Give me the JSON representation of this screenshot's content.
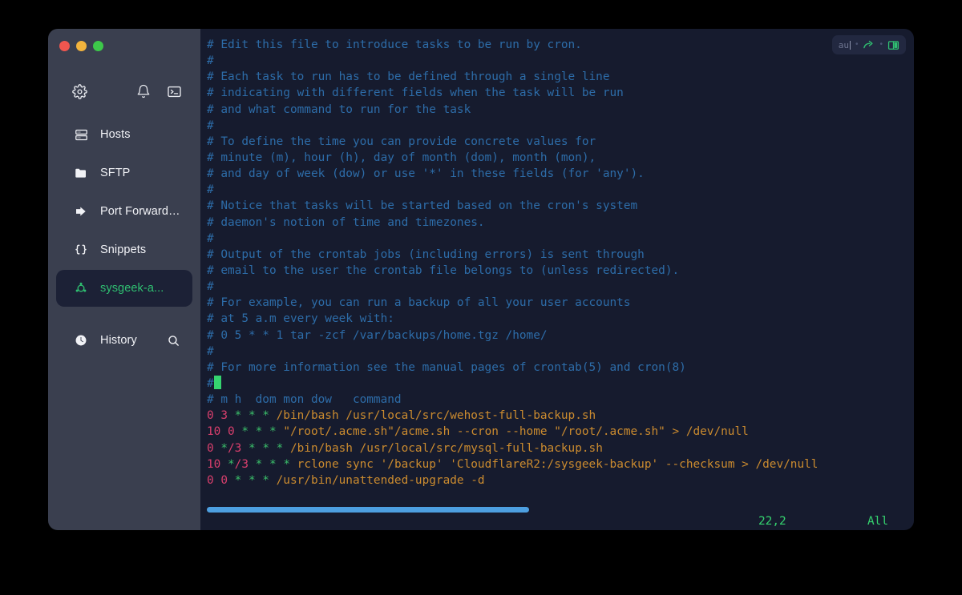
{
  "window": {
    "traffic_lights": [
      {
        "name": "close",
        "color": "#f0564f"
      },
      {
        "name": "minimize",
        "color": "#f2b33d"
      },
      {
        "name": "zoom",
        "color": "#3dc84a"
      }
    ]
  },
  "sidebar": {
    "top_icons": [
      {
        "name": "gear-icon",
        "label": "Settings"
      },
      {
        "name": "bell-icon",
        "label": "Notifications"
      },
      {
        "name": "terminal-icon",
        "label": "Terminal"
      }
    ],
    "items": [
      {
        "label": "Hosts",
        "icon": "server-icon",
        "active": false
      },
      {
        "label": "SFTP",
        "icon": "folder-icon",
        "active": false
      },
      {
        "label": "Port Forwarding",
        "icon": "forward-arrow-icon",
        "active": false
      },
      {
        "label": "Snippets",
        "icon": "braces-icon",
        "active": false
      },
      {
        "label": "sysgeek-a...",
        "icon": "ubuntu-icon",
        "active": true
      }
    ],
    "history": {
      "label": "History",
      "icon": "clock-icon",
      "trailing_icon": "search-icon"
    },
    "accent_color": "#2fbf71",
    "background_color": "#3a3f4f",
    "active_background_color": "#1c2136"
  },
  "terminal": {
    "background_color": "#161b2e",
    "toolbar": {
      "text": "au",
      "send_icon": "share-arrow-icon",
      "split_icon": "split-pane-icon",
      "accent_color": "#2fbf71"
    },
    "colors": {
      "comment": "#2d6ca8",
      "number": "#d93f6d",
      "asterisk": "#3bbf6a",
      "path": "#cb8b2f",
      "cursor": "#35d46f",
      "scrollbar": "#4d9fe0",
      "status": "#35d46f"
    },
    "lines": [
      [
        {
          "t": "# Edit this file to introduce tasks to be run by cron.",
          "c": "comment"
        }
      ],
      [
        {
          "t": "#",
          "c": "comment"
        }
      ],
      [
        {
          "t": "# Each task to run has to be defined through a single line",
          "c": "comment"
        }
      ],
      [
        {
          "t": "# indicating with different fields when the task will be run",
          "c": "comment"
        }
      ],
      [
        {
          "t": "# and what command to run for the task",
          "c": "comment"
        }
      ],
      [
        {
          "t": "#",
          "c": "comment"
        }
      ],
      [
        {
          "t": "# To define the time you can provide concrete values for",
          "c": "comment"
        }
      ],
      [
        {
          "t": "# minute (m), hour (h), day of month (dom), month (mon),",
          "c": "comment"
        }
      ],
      [
        {
          "t": "# and day of week (dow) or use '*' in these fields (for 'any').",
          "c": "comment"
        }
      ],
      [
        {
          "t": "#",
          "c": "comment"
        }
      ],
      [
        {
          "t": "# Notice that tasks will be started based on the cron's system",
          "c": "comment"
        }
      ],
      [
        {
          "t": "# daemon's notion of time and timezones.",
          "c": "comment"
        }
      ],
      [
        {
          "t": "#",
          "c": "comment"
        }
      ],
      [
        {
          "t": "# Output of the crontab jobs (including errors) is sent through",
          "c": "comment"
        }
      ],
      [
        {
          "t": "# email to the user the crontab file belongs to (unless redirected).",
          "c": "comment"
        }
      ],
      [
        {
          "t": "#",
          "c": "comment"
        }
      ],
      [
        {
          "t": "# For example, you can run a backup of all your user accounts",
          "c": "comment"
        }
      ],
      [
        {
          "t": "# at 5 a.m every week with:",
          "c": "comment"
        }
      ],
      [
        {
          "t": "# 0 5 * * 1 tar -zcf /var/backups/home.tgz /home/",
          "c": "comment"
        }
      ],
      [
        {
          "t": "#",
          "c": "comment"
        }
      ],
      [
        {
          "t": "# For more information see the manual pages of crontab(5) and cron(8)",
          "c": "comment"
        }
      ],
      [
        {
          "t": "#",
          "c": "comment"
        },
        {
          "t": "",
          "c": "cursor"
        }
      ],
      [
        {
          "t": "# m h  dom mon dow   command",
          "c": "comment"
        }
      ],
      [
        {
          "t": "0 3 ",
          "c": "num"
        },
        {
          "t": "* * * ",
          "c": "star"
        },
        {
          "t": "/bin/bash /usr/local/src/wehost-full-backup.sh",
          "c": "path"
        }
      ],
      [
        {
          "t": "10 0 ",
          "c": "num"
        },
        {
          "t": "* * * ",
          "c": "star"
        },
        {
          "t": "\"/root/.acme.sh\"/acme.sh --cron --home \"/root/.acme.sh\" > /dev/null",
          "c": "path"
        }
      ],
      [
        {
          "t": "0 ",
          "c": "num"
        },
        {
          "t": "*",
          "c": "star"
        },
        {
          "t": "/3 ",
          "c": "num"
        },
        {
          "t": "* * * ",
          "c": "star"
        },
        {
          "t": "/bin/bash /usr/local/src/mysql-full-backup.sh",
          "c": "path"
        }
      ],
      [
        {
          "t": "10 ",
          "c": "num"
        },
        {
          "t": "*",
          "c": "star"
        },
        {
          "t": "/3 ",
          "c": "num"
        },
        {
          "t": "* * * ",
          "c": "star"
        },
        {
          "t": "rclone sync '/backup' 'CloudflareR2:/sysgeek-backup' --checksum > /dev/null",
          "c": "path"
        }
      ],
      [
        {
          "t": "0 0 ",
          "c": "num"
        },
        {
          "t": "* * * ",
          "c": "star"
        },
        {
          "t": "/usr/bin/unattended-upgrade -d",
          "c": "path"
        }
      ]
    ],
    "status": {
      "position": "22,2",
      "scope": "All"
    },
    "scrollbar_percent": 46
  }
}
